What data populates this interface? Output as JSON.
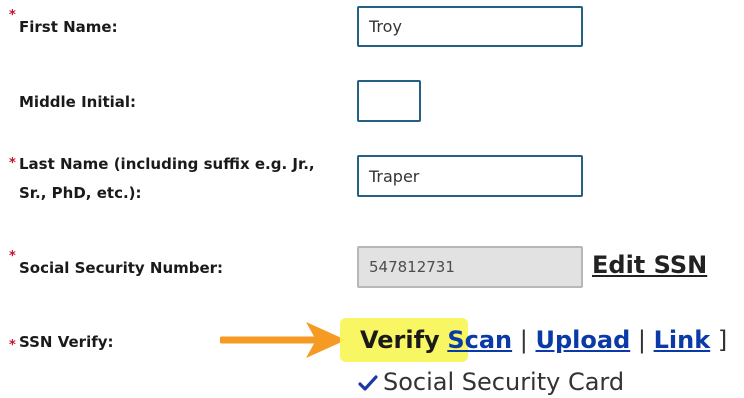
{
  "colors": {
    "required_asterisk": "#c8102e",
    "input_border": "#245f84",
    "link": "#0a3aa8",
    "highlight": "#f8f55a",
    "arrow": "#f59a23",
    "check": "#1c3aa3"
  },
  "form": {
    "required_marker": "*",
    "first_name": {
      "label": "First Name:",
      "value": "Troy"
    },
    "middle_initial": {
      "label": "Middle Initial:",
      "value": ""
    },
    "last_name": {
      "label_line1": "Last Name (including suffix e.g. Jr.,",
      "label_line2": "Sr., PhD, etc.):",
      "value": "Traper"
    },
    "ssn": {
      "label": "Social Security Number:",
      "value": "547812731",
      "edit_link": "Edit SSN"
    },
    "ssn_verify": {
      "label": "SSN Verify:",
      "verify": "Verify",
      "scan": "Scan",
      "upload": "Upload",
      "link": "Link",
      "separator": "|",
      "close_bracket": "]",
      "verified_item": "Social Security Card",
      "check_icon": "checkmark-icon",
      "arrow_icon": "arrow-right-icon"
    }
  }
}
